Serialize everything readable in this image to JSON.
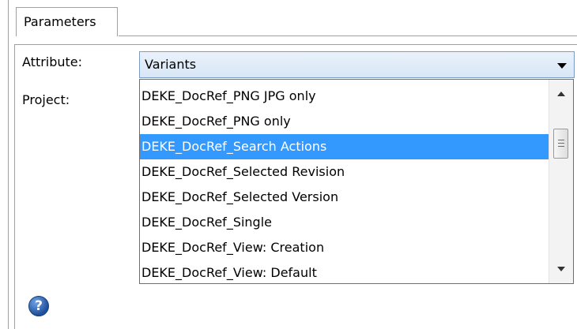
{
  "tab": {
    "label": "Parameters"
  },
  "form": {
    "attribute_label": "Attribute:",
    "attribute_value": "Variants",
    "project_label": "Project:"
  },
  "dropdown": {
    "options": [
      {
        "label": "DEKE_DocRef_PNG JPG only"
      },
      {
        "label": "DEKE_DocRef_PNG only"
      },
      {
        "label": "DEKE_DocRef_Search Actions"
      },
      {
        "label": "DEKE_DocRef_Selected Revision"
      },
      {
        "label": "DEKE_DocRef_Selected Version"
      },
      {
        "label": "DEKE_DocRef_Single"
      },
      {
        "label": "DEKE_DocRef_View: Creation"
      },
      {
        "label": "DEKE_DocRef_View: Default"
      }
    ],
    "selected_option": "DEKE_DocRef_Search Actions"
  },
  "help": {
    "glyph": "?",
    "icon": "help-icon"
  },
  "colors": {
    "selection": "#3399ff",
    "help_icon": "#2b5fb4"
  }
}
